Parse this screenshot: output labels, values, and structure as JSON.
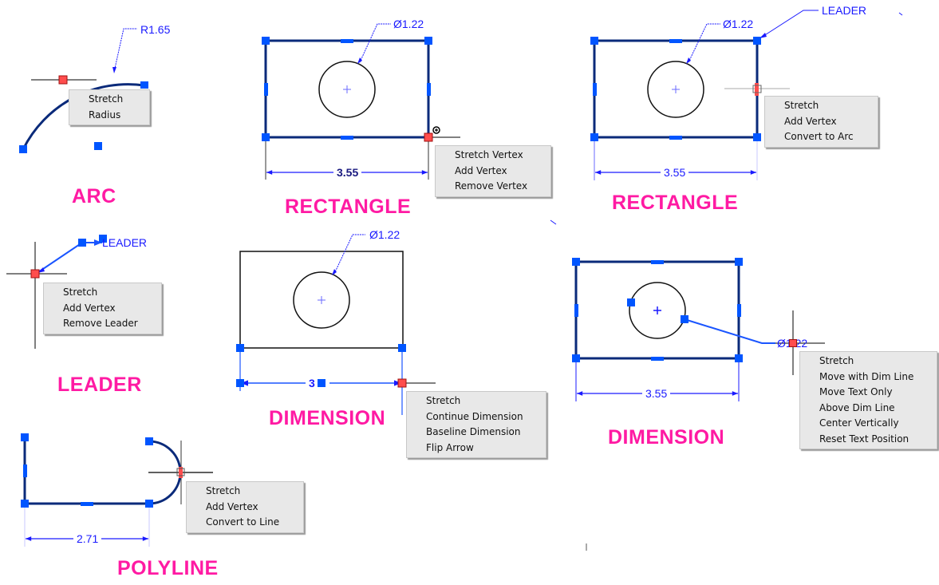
{
  "colors": {
    "title": "#ff1aa3",
    "annotation": "#1a1aff",
    "grip": "#0055ff",
    "hot_grip": "#ff4d4d",
    "geometry": "#0a2a7a",
    "menu_bg": "#e8e8e8"
  },
  "panels": {
    "arc": {
      "title": "ARC",
      "dimension": "R1.65",
      "menu": [
        "Stretch",
        "Radius"
      ]
    },
    "rectangle_vertex": {
      "title": "RECTANGLE",
      "diameter": "Ø1.22",
      "width_dim": "3.55",
      "menu": [
        "Stretch Vertex",
        "Add Vertex",
        "Remove Vertex"
      ]
    },
    "rectangle_edge": {
      "title": "RECTANGLE",
      "diameter": "Ø1.22",
      "leader": "LEADER",
      "width_dim": "3.55",
      "menu": [
        "Stretch",
        "Add Vertex",
        "Convert to Arc"
      ]
    },
    "leader": {
      "title": "LEADER",
      "leader_text": "LEADER",
      "menu": [
        "Stretch",
        "Add Vertex",
        "Remove Leader"
      ]
    },
    "dimension_linear": {
      "title": "DIMENSION",
      "diameter": "Ø1.22",
      "width_dim": "3.55",
      "width_dim_obscured": "3  5",
      "menu": [
        "Stretch",
        "Continue Dimension",
        "Baseline Dimension",
        "Flip Arrow"
      ]
    },
    "dimension_diameter": {
      "title": "DIMENSION",
      "diameter": "Ø1.22",
      "diameter_obscured": "Ø1 22",
      "width_dim": "3.55",
      "menu": [
        "Stretch",
        "Move with Dim Line",
        "Move Text Only",
        "Above Dim Line",
        "Center Vertically",
        "Reset Text Position"
      ]
    },
    "polyline": {
      "title": "POLYLINE",
      "width_dim": "2.71",
      "menu": [
        "Stretch",
        "Add Vertex",
        "Convert to Line"
      ]
    }
  }
}
